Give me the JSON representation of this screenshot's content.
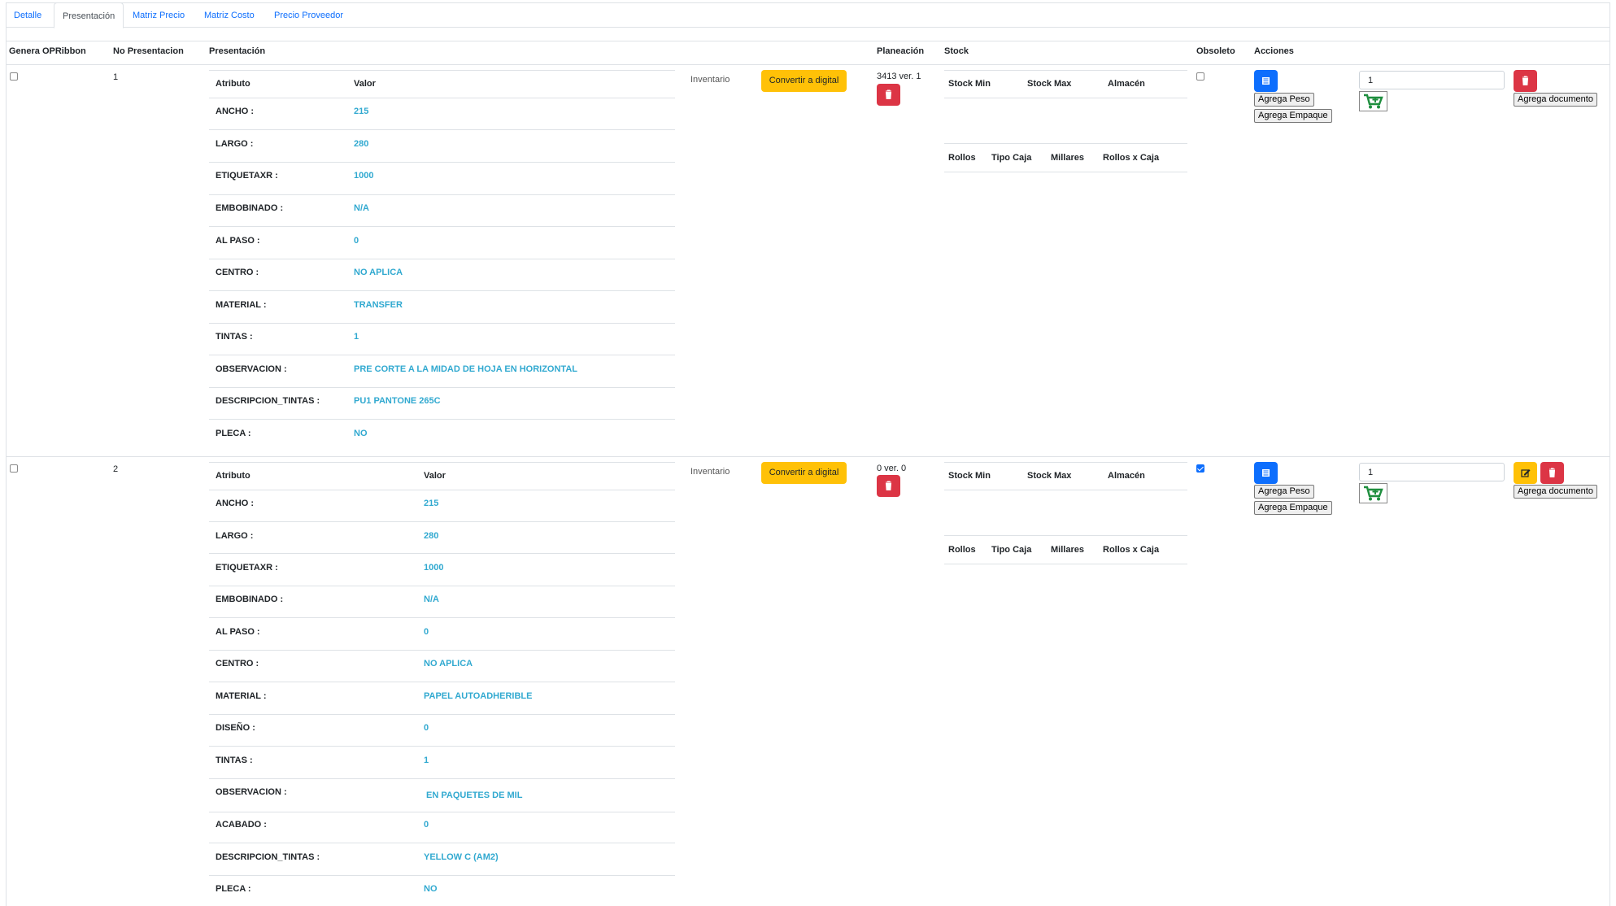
{
  "tabs": [
    "Detalle",
    "Presentación",
    "Matriz Precio",
    "Matriz Costo",
    "Precio Proveedor"
  ],
  "active_tab": 1,
  "columns": {
    "genera": "Genera OPRibbon",
    "no_presentacion": "No Presentacion",
    "presentacion": "Presentación",
    "planeacion": "Planeación",
    "stock": "Stock",
    "obsoleto": "Obsoleto",
    "acciones": "Acciones"
  },
  "attr_headers": {
    "atributo": "Atributo",
    "valor": "Valor"
  },
  "stock_headers": {
    "stock_min": "Stock Min",
    "stock_max": "Stock Max",
    "almacen": "Almacén",
    "rollos": "Rollos",
    "tipo_caja": "Tipo Caja",
    "millares": "Millares",
    "rollos_caja": "Rollos x Caja"
  },
  "labels": {
    "inventario": "Inventario",
    "convertir": "Convertir a digital",
    "agrega_peso": "Agrega Peso",
    "agrega_empaque": "Agrega Empaque",
    "agrega_documento": "Agrega documento"
  },
  "icons": {
    "trash": "trash-icon",
    "list": "list-icon",
    "edit": "edit-icon",
    "cart": "cart-plus-icon"
  },
  "colors": {
    "link": "#0d6efd",
    "value": "#31a9d0",
    "warning": "#ffc107",
    "danger": "#dc3545",
    "primary": "#0d6efd",
    "cart": "#1e8e3e"
  },
  "rows": [
    {
      "genera_checked": false,
      "number": "1",
      "planeacion": "3413 ver. 1",
      "obsoleto": false,
      "quantity": "1",
      "attributes": [
        {
          "k": "ANCHO :",
          "v": "215"
        },
        {
          "k": "LARGO :",
          "v": "280"
        },
        {
          "k": "ETIQUETAXR :",
          "v": "1000"
        },
        {
          "k": "EMBOBINADO :",
          "v": "N/A"
        },
        {
          "k": "AL PASO :",
          "v": "0"
        },
        {
          "k": "CENTRO :",
          "v": "NO APLICA"
        },
        {
          "k": "MATERIAL :",
          "v": "TRANSFER"
        },
        {
          "k": "TINTAS :",
          "v": "1"
        },
        {
          "k": "OBSERVACION :",
          "v": "PRE CORTE A LA MIDAD DE HOJA EN HORIZONTAL"
        },
        {
          "k": "DESCRIPCION_TINTAS :",
          "v": "PU1 PANTONE 265C"
        },
        {
          "k": "PLECA :",
          "v": "NO"
        }
      ]
    },
    {
      "genera_checked": false,
      "number": "2",
      "planeacion": "0 ver. 0",
      "obsoleto": true,
      "quantity": "1",
      "attributes": [
        {
          "k": "ANCHO :",
          "v": "215"
        },
        {
          "k": "LARGO :",
          "v": "280"
        },
        {
          "k": "ETIQUETAXR :",
          "v": "1000"
        },
        {
          "k": "EMBOBINADO :",
          "v": "N/A"
        },
        {
          "k": "AL PASO :",
          "v": "0"
        },
        {
          "k": "CENTRO :",
          "v": "NO APLICA"
        },
        {
          "k": "MATERIAL :",
          "v": "PAPEL AUTOADHERIBLE"
        },
        {
          "k": "DISEÑO :",
          "v": "0"
        },
        {
          "k": "TINTAS :",
          "v": "1"
        },
        {
          "k": "OBSERVACION :",
          "v": " EN PAQUETES DE MIL"
        },
        {
          "k": "ACABADO :",
          "v": "0"
        },
        {
          "k": "DESCRIPCION_TINTAS :",
          "v": "YELLOW C (AM2)"
        },
        {
          "k": "PLECA :",
          "v": "NO"
        }
      ]
    }
  ]
}
